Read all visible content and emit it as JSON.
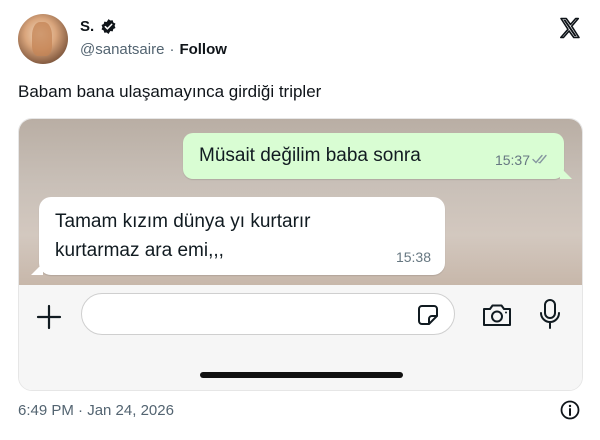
{
  "author": {
    "display_name": "S.",
    "handle": "@sanatsaire",
    "separator": "·",
    "follow_label": "Follow",
    "avatar_icon": "avatar-photo",
    "verified_icon": "verified-badge-icon"
  },
  "tweet": {
    "text": "Babam bana ulaşamayınca girdiği tripler",
    "timestamp": "6:49 PM · Jan 24, 2026"
  },
  "chat": {
    "outgoing": {
      "text": "Müsait değilim baba sonra",
      "time": "15:37",
      "status_icon": "double-check-icon"
    },
    "incoming": {
      "text": "Tamam kızım dünya yı kurtarır\nkurtarmaz ara emi,,,",
      "time": "15:38"
    },
    "input": {
      "placeholder": "",
      "icons": [
        "plus-icon",
        "sticker-icon",
        "camera-icon",
        "microphone-icon"
      ]
    }
  },
  "colors": {
    "outgoing_bubble": "#d9fdd3",
    "incoming_bubble": "#ffffff",
    "muted_text": "#536471"
  }
}
